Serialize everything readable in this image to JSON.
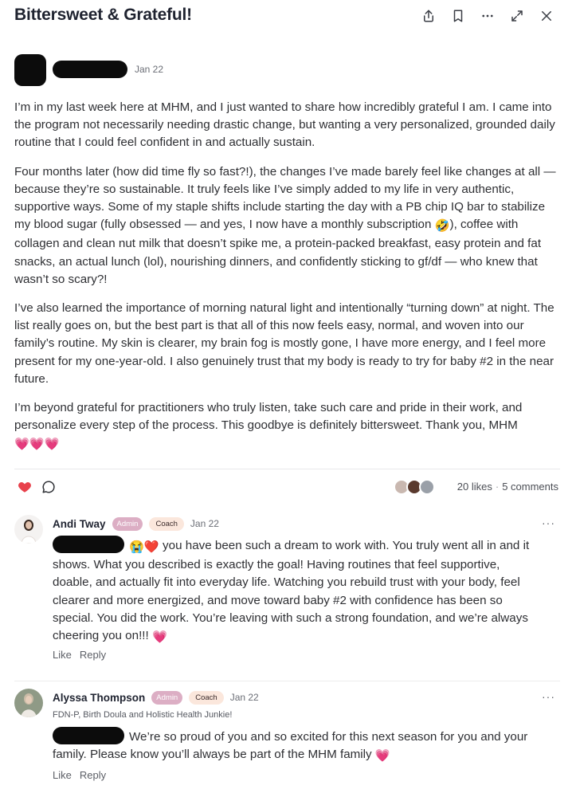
{
  "post": {
    "title": "Bittersweet & Grateful!",
    "date": "Jan 22",
    "paragraphs": [
      "I’m in my last week here at MHM, and I just wanted to share how incredibly grateful I am. I came into the program not necessarily needing drastic change, but wanting a very personalized, grounded daily routine that I could feel confident in and actually sustain.",
      "Four months later (how did time fly so fast?!), the changes I’ve made barely feel like changes at all — because they’re so sustainable. It truly feels like I’ve simply added to my life in very authentic, supportive ways. Some of my staple shifts include starting the day with a PB chip IQ bar to stabilize my blood sugar (fully obsessed — and yes, I now have a monthly subscription",
      "), coffee with collagen and clean nut milk that doesn’t spike me, a protein-packed breakfast, easy protein and fat snacks, an actual lunch (lol), nourishing dinners, and confidently sticking to gf/df — who knew that wasn’t so scary?!",
      "I’ve also learned the importance of morning natural light and intentionally “turning down” at night. The list really goes on, but the best part is that all of this now feels easy, normal, and woven into our family’s routine. My skin is clearer, my brain fog is mostly gone, I have more energy, and I feel more present for my one-year-old. I also genuinely trust that my body is ready to try for baby #2 in the near future.",
      "I’m beyond grateful for practitioners who truly listen, take such care and pride in their work, and personalize every step of the process. This goodbye is definitely bittersweet. Thank you, MHM"
    ],
    "emoji_laugh": "🤣",
    "emoji_hearts": "💗💗💗",
    "likes": "20 likes",
    "separator": "·",
    "comments_count": "5 comments"
  },
  "comments": [
    {
      "name": "Andi Tway",
      "badge_admin": "Admin",
      "badge_coach": "Coach",
      "date": "Jan 22",
      "emoji_lead": "😭❤️",
      "text": " you have been such a dream to work with. You truly went all in and it shows. What you described is exactly the goal! Having routines that feel supportive, doable, and actually fit into everyday life. Watching you rebuild trust with your body, feel clearer and more energized, and move toward baby #2 with confidence has been so special. You did the work. You’re leaving with such a strong foundation, and we’re always cheering you on!!! ",
      "emoji_tail": "💗",
      "like": "Like",
      "reply": "Reply",
      "more": "···"
    },
    {
      "name": "Alyssa Thompson",
      "badge_admin": "Admin",
      "badge_coach": "Coach",
      "date": "Jan 22",
      "subtitle": "FDN-P, Birth Doula and Holistic Health Junkie!",
      "text": "We’re so proud of you and so excited for this next season for you and your family. Please know you’ll always be part of the MHM family ",
      "emoji_tail": "💗",
      "like": "Like",
      "reply": "Reply",
      "more": "···"
    }
  ],
  "icons": {
    "header": [
      "share-icon",
      "bookmark-icon",
      "more-icon",
      "expand-icon",
      "close-icon"
    ],
    "actions": [
      "heart-icon",
      "comment-icon"
    ]
  },
  "colors": {
    "heart": "#e8414c",
    "badge_admin": "#dcaec4",
    "badge_coach": "#fbe7dc",
    "title": "#1f2330"
  }
}
